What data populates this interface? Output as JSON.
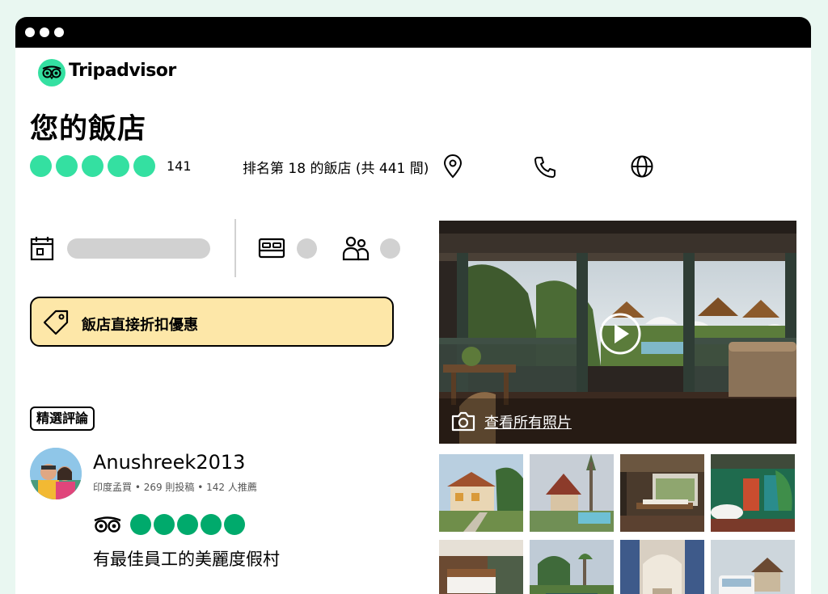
{
  "brand": {
    "name": "Tripadvisor"
  },
  "hotel": {
    "title": "您的飯店",
    "rating_bubbles": 5,
    "review_count": "141",
    "ranking": "排名第 18 的飯店 (共 441 間)"
  },
  "deal": {
    "label": "飯店直接折扣優惠"
  },
  "featured": {
    "label": "精選評論"
  },
  "review": {
    "reviewer": "Anushreek2013",
    "meta": "印度孟買 • 269 則投稿 • 142 人推薦",
    "rating_bubbles": 5,
    "headline": "有最佳員工的美麗度假村"
  },
  "photos": {
    "see_all": "查看所有照片"
  },
  "colors": {
    "brand_green": "#34e0a1",
    "rating_green": "#00aa6c",
    "deal_bg": "#fde7a8",
    "placeholder_gray": "#d1d1d1"
  },
  "icons": [
    "tripadvisor-owl-icon",
    "map-pin-icon",
    "phone-icon",
    "globe-icon",
    "calendar-icon",
    "bed-icon",
    "guests-icon",
    "tag-icon",
    "play-icon",
    "camera-icon"
  ]
}
